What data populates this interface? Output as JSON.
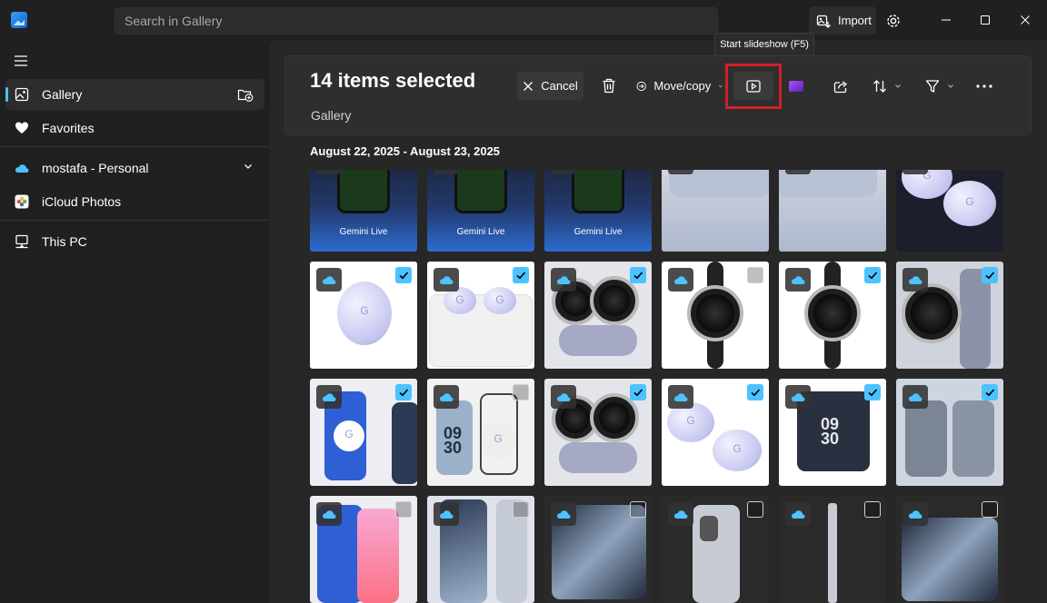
{
  "search": {
    "placeholder": "Search in Gallery"
  },
  "titlebar": {
    "import_label": "Import"
  },
  "sidebar": {
    "items": [
      {
        "label": "Gallery"
      },
      {
        "label": "Favorites"
      },
      {
        "label": "mostafa - Personal"
      },
      {
        "label": "iCloud Photos"
      },
      {
        "label": "This PC"
      }
    ]
  },
  "header": {
    "title": "14 items selected",
    "breadcrumb": "Gallery"
  },
  "toolbar": {
    "cancel_label": "Cancel",
    "move_copy_label": "Move/copy",
    "tooltip": "Start slideshow (F5)"
  },
  "date_group": "August 22, 2025 - August 23, 2025",
  "photos": [
    {
      "caption": "Gemini Live",
      "selected": false
    },
    {
      "caption": "Gemini Live",
      "selected": false
    },
    {
      "caption": "Gemini Live",
      "selected": true
    },
    {
      "caption": "",
      "selected": true
    },
    {
      "caption": "",
      "selected": true
    },
    {
      "caption": "",
      "selected": true
    },
    {
      "caption": "",
      "selected": true
    },
    {
      "caption": "",
      "selected": true
    },
    {
      "caption": "",
      "selected": true
    },
    {
      "caption": "",
      "selected": false
    },
    {
      "caption": "",
      "selected": true
    },
    {
      "caption": "",
      "selected": true
    },
    {
      "caption": "",
      "selected": true
    },
    {
      "caption": "",
      "selected": false
    },
    {
      "caption": "",
      "selected": true
    },
    {
      "caption": "",
      "selected": true
    },
    {
      "caption": "",
      "selected": true
    },
    {
      "caption": "",
      "selected": true
    },
    {
      "caption": "",
      "selected": false
    },
    {
      "caption": "",
      "selected": false
    },
    {
      "caption": "",
      "selected": false
    },
    {
      "caption": "",
      "selected": false
    },
    {
      "caption": "",
      "selected": false
    },
    {
      "caption": "",
      "selected": false
    }
  ],
  "colors": {
    "accent": "#4cc2ff",
    "highlight": "#d21f2a"
  }
}
